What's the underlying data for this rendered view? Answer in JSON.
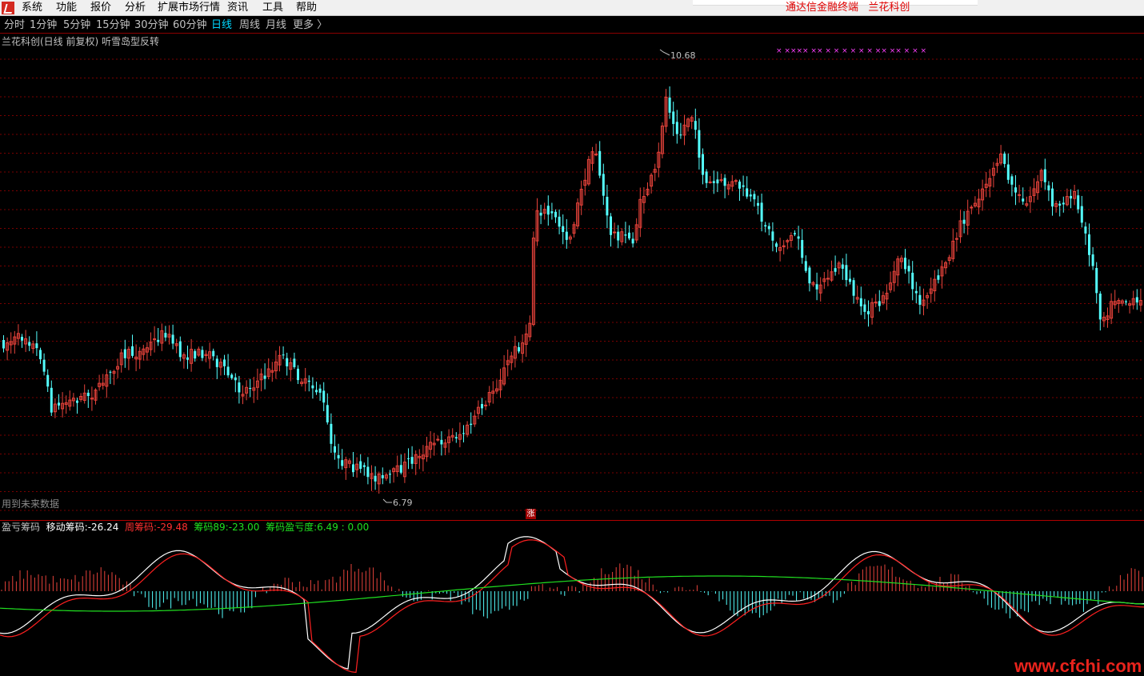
{
  "menu": {
    "items": [
      "系统",
      "功能",
      "报价",
      "分析",
      "扩展市场行情",
      "资讯",
      "工具",
      "帮助"
    ],
    "brand": "通达信金融终端   兰花科创"
  },
  "periods": {
    "items": [
      "分时",
      "1分钟",
      "5分钟",
      "15分钟",
      "30分钟",
      "60分钟",
      "日线",
      "周线",
      "月线",
      "更多 〉"
    ],
    "active_index": 6
  },
  "main": {
    "title": "兰花科创(日线 前复权) 听雪岛型反转",
    "high_label": "10.68",
    "low_label": "6.79",
    "future_label": "用到未来数据",
    "badge": "涨",
    "markers": "×  ××××  ××  ×  ×  ×  ×  ×  ×  ××  ××  ×  ×  ×"
  },
  "indicator": {
    "name": "盈亏筹码",
    "move_label": "移动筹码:",
    "move_value": "-26.24",
    "week_label": "周筹码:",
    "week_value": "-29.48",
    "chip89_label": "筹码89:",
    "chip89_value": "-23.00",
    "pl_label": "筹码盈亏度:",
    "pl_value": "6.49 : 0.00"
  },
  "colors": {
    "up": "#e8433b",
    "down": "#54ffff",
    "grid": "#7a0000",
    "white_line": "#ffffff",
    "red_line": "#ff2020",
    "green_line": "#20e020",
    "marker": "#ff40ff"
  },
  "watermark": "www.cfchi.com"
}
